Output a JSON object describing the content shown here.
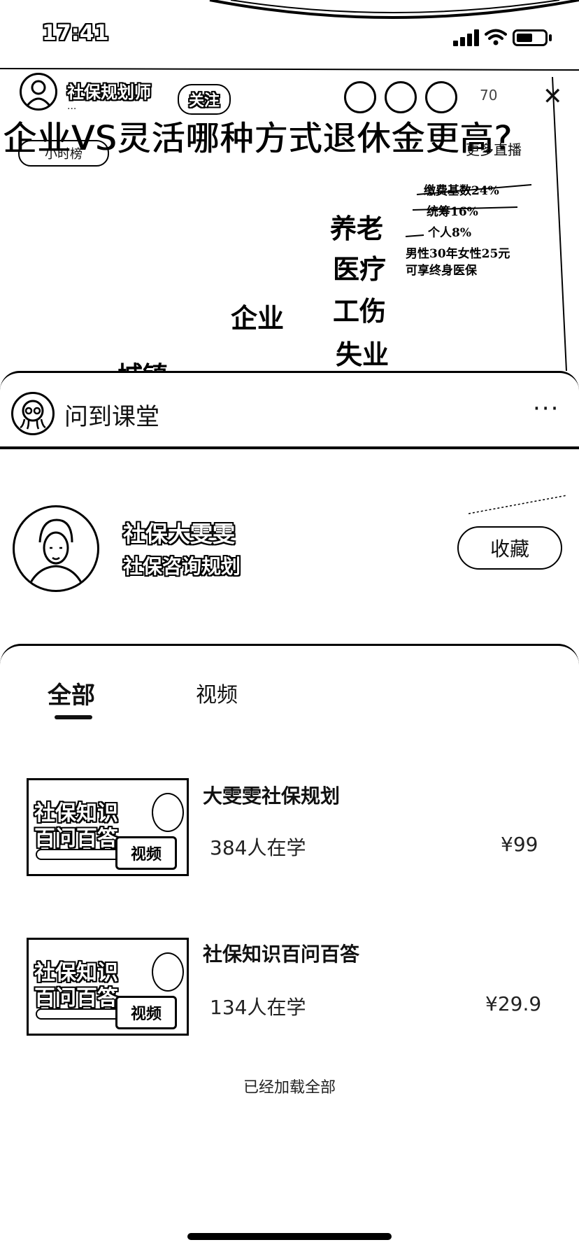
{
  "status_bar": {
    "time": "17:41",
    "wifi_icon": "wifi-icon",
    "signal_icon": "signal-icon",
    "battery_icon": "battery-icon"
  },
  "live": {
    "host_name": "社保规划师",
    "host_sub": "...",
    "follow_label": "关注",
    "viewer_count": "70",
    "close_icon": "close-icon",
    "rank_label": "小时榜",
    "more_live_label": "更多直播",
    "video_title": "企业VS灵活哪种方式退休金更高?",
    "board_text": [
      "养老",
      "医疗",
      "工伤",
      "失业",
      "企业",
      "城镇"
    ],
    "board_notes": [
      "缴费基数24%",
      "统筹16%",
      "个人8%",
      "男性30年女性25元",
      "可享终身医保"
    ]
  },
  "sheet": {
    "title": "问到课堂",
    "more_icon": "more-icon",
    "more_label": "···",
    "teacher": {
      "name": "社保大雯雯",
      "role": "社保咨询规划",
      "favorite_label": "收藏"
    },
    "tabs": [
      {
        "label": "全部",
        "active": true
      },
      {
        "label": "视频",
        "active": false
      }
    ],
    "courses": [
      {
        "title": "大雯雯社保规划",
        "learners": "384人在学",
        "price": "¥99",
        "thumb_line1": "社保知识",
        "thumb_line2": "百问百答",
        "badge": "视频"
      },
      {
        "title": "社保知识百问百答",
        "learners": "134人在学",
        "price": "¥29.9",
        "thumb_line1": "社保知识",
        "thumb_line2": "百问百答",
        "badge": "视频"
      }
    ],
    "footer": "已经加载全部"
  }
}
